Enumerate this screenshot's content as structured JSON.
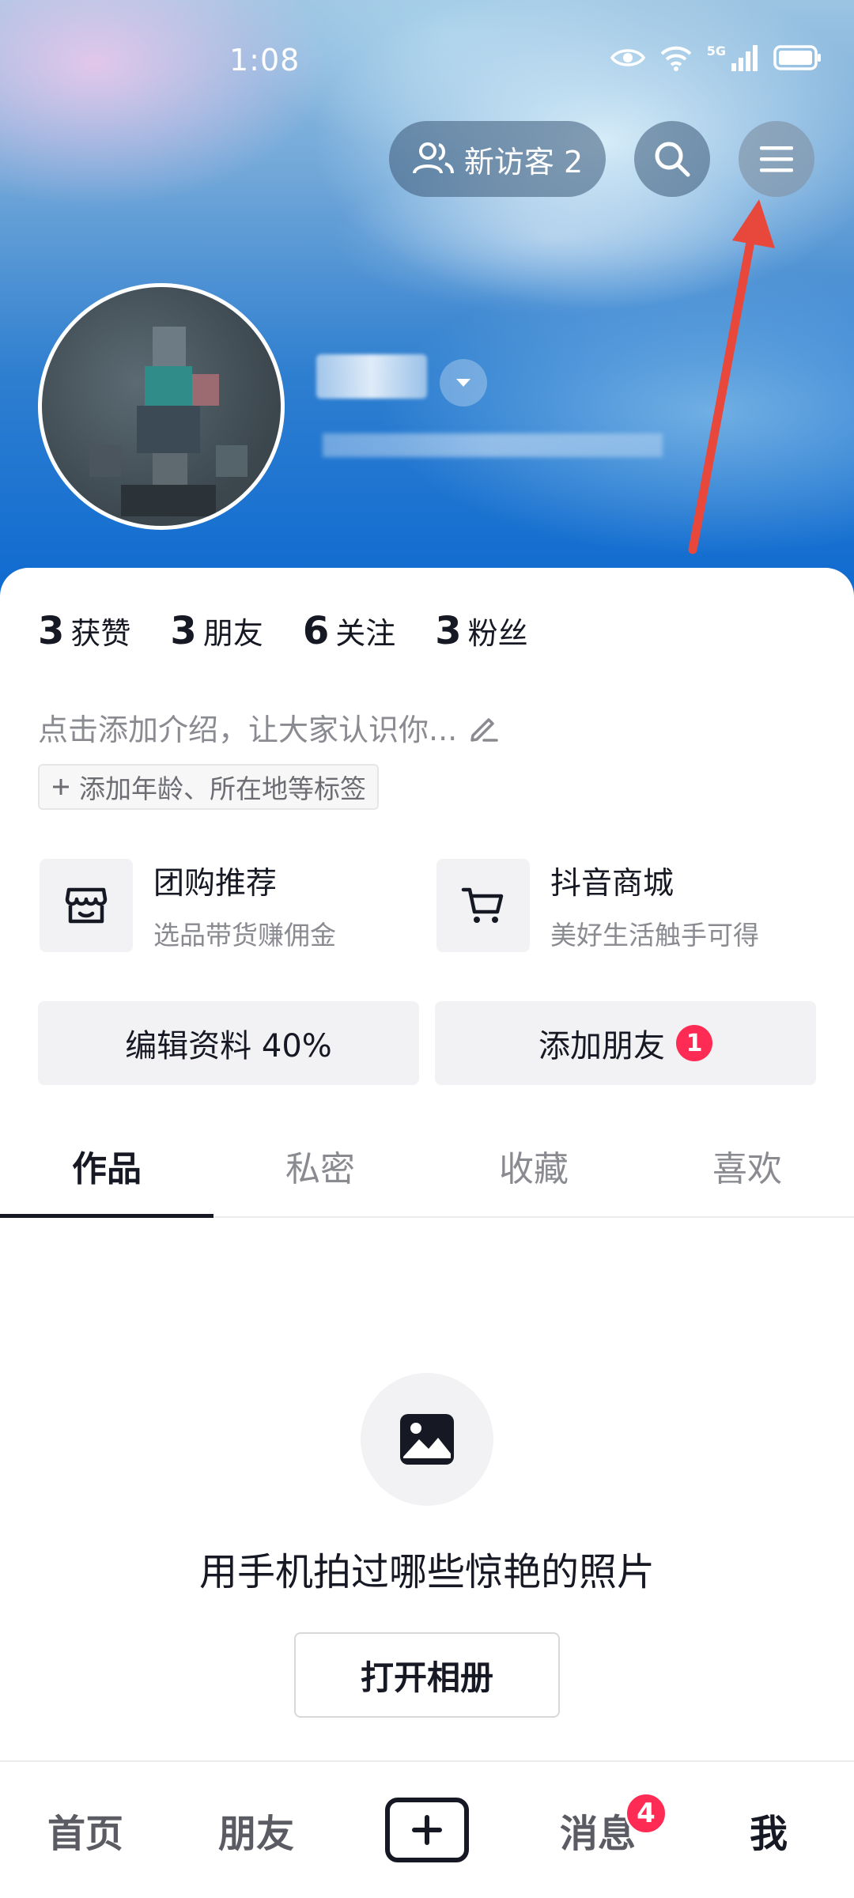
{
  "status_bar": {
    "time": "1:08",
    "network": "5G"
  },
  "header": {
    "visitors_label": "新访客 2",
    "icons": {
      "visitors": "people-icon",
      "search": "search-icon",
      "menu": "hamburger-menu-icon"
    }
  },
  "profile": {
    "stats": [
      {
        "value": "3",
        "label": "获赞"
      },
      {
        "value": "3",
        "label": "朋友"
      },
      {
        "value": "6",
        "label": "关注"
      },
      {
        "value": "3",
        "label": "粉丝"
      }
    ],
    "bio_placeholder": "点击添加介绍，让大家认识你...",
    "tag_chip": "添加年龄、所在地等标签"
  },
  "services": [
    {
      "title": "团购推荐",
      "subtitle": "选品带货赚佣金",
      "icon": "shop-basket-icon"
    },
    {
      "title": "抖音商城",
      "subtitle": "美好生活触手可得",
      "icon": "shopping-cart-icon"
    }
  ],
  "actions": {
    "edit_profile": "编辑资料 40%",
    "add_friends": "添加朋友",
    "add_friends_badge": "1"
  },
  "tabs": [
    {
      "label": "作品",
      "active": true
    },
    {
      "label": "私密",
      "active": false
    },
    {
      "label": "收藏",
      "active": false
    },
    {
      "label": "喜欢",
      "active": false
    }
  ],
  "empty_state": {
    "icon": "image-icon",
    "message": "用手机拍过哪些惊艳的照片",
    "button": "打开相册"
  },
  "bottom_nav": {
    "items": [
      {
        "label": "首页",
        "active": false
      },
      {
        "label": "朋友",
        "active": false
      },
      {
        "label": "",
        "icon": "plus-icon"
      },
      {
        "label": "消息",
        "badge": "4",
        "active": false
      },
      {
        "label": "我",
        "active": true
      }
    ]
  },
  "colors": {
    "accent_red": "#fe2c55",
    "text_primary": "#161823",
    "text_secondary": "#8a8b91",
    "annotation_arrow": "#e8483c"
  }
}
